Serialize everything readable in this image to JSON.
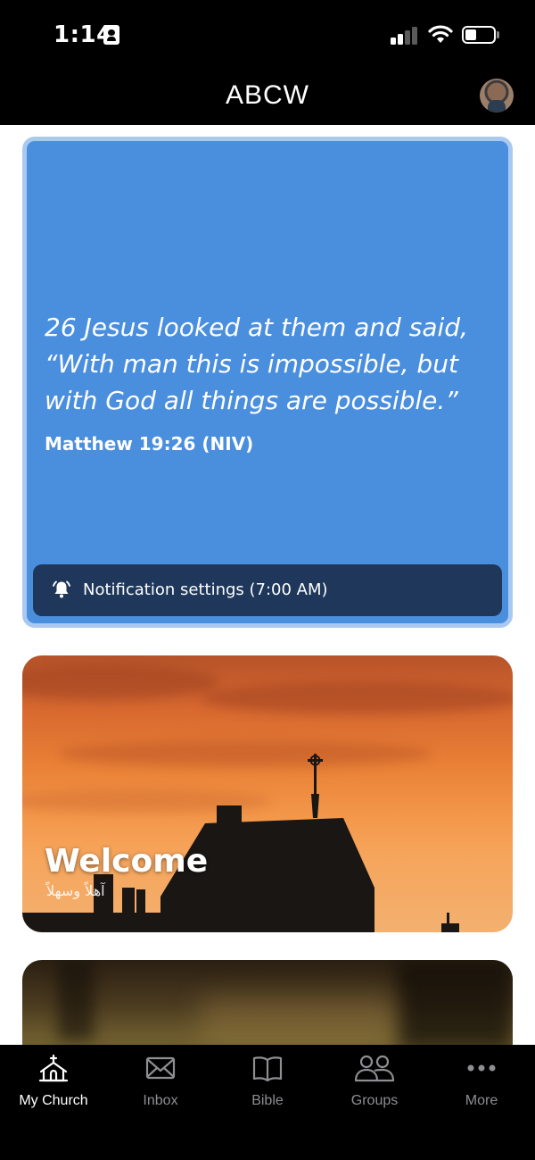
{
  "status_bar": {
    "time": "1:14"
  },
  "header": {
    "title": "ABCW"
  },
  "verse_card": {
    "text": "26 Jesus looked at them and said, “With man this is impossible, but with God all things are possible.”",
    "reference": "Matthew 19:26 (NIV)",
    "notification_label": "Notification settings (7:00 AM)"
  },
  "welcome_card": {
    "title": "Welcome",
    "subtitle": "آهلاً وسهلاً"
  },
  "tab_bar": {
    "active_color": "#ffffff",
    "inactive_color": "#8e8e93",
    "tabs": [
      {
        "label": "My Church",
        "icon": "church-icon"
      },
      {
        "label": "Inbox",
        "icon": "envelope-icon"
      },
      {
        "label": "Bible",
        "icon": "book-icon"
      },
      {
        "label": "Groups",
        "icon": "people-icon"
      },
      {
        "label": "More",
        "icon": "ellipsis-icon"
      }
    ]
  },
  "colors": {
    "verse_card_bg": "#4a8ede",
    "notification_bar_bg": "#1e375a"
  }
}
